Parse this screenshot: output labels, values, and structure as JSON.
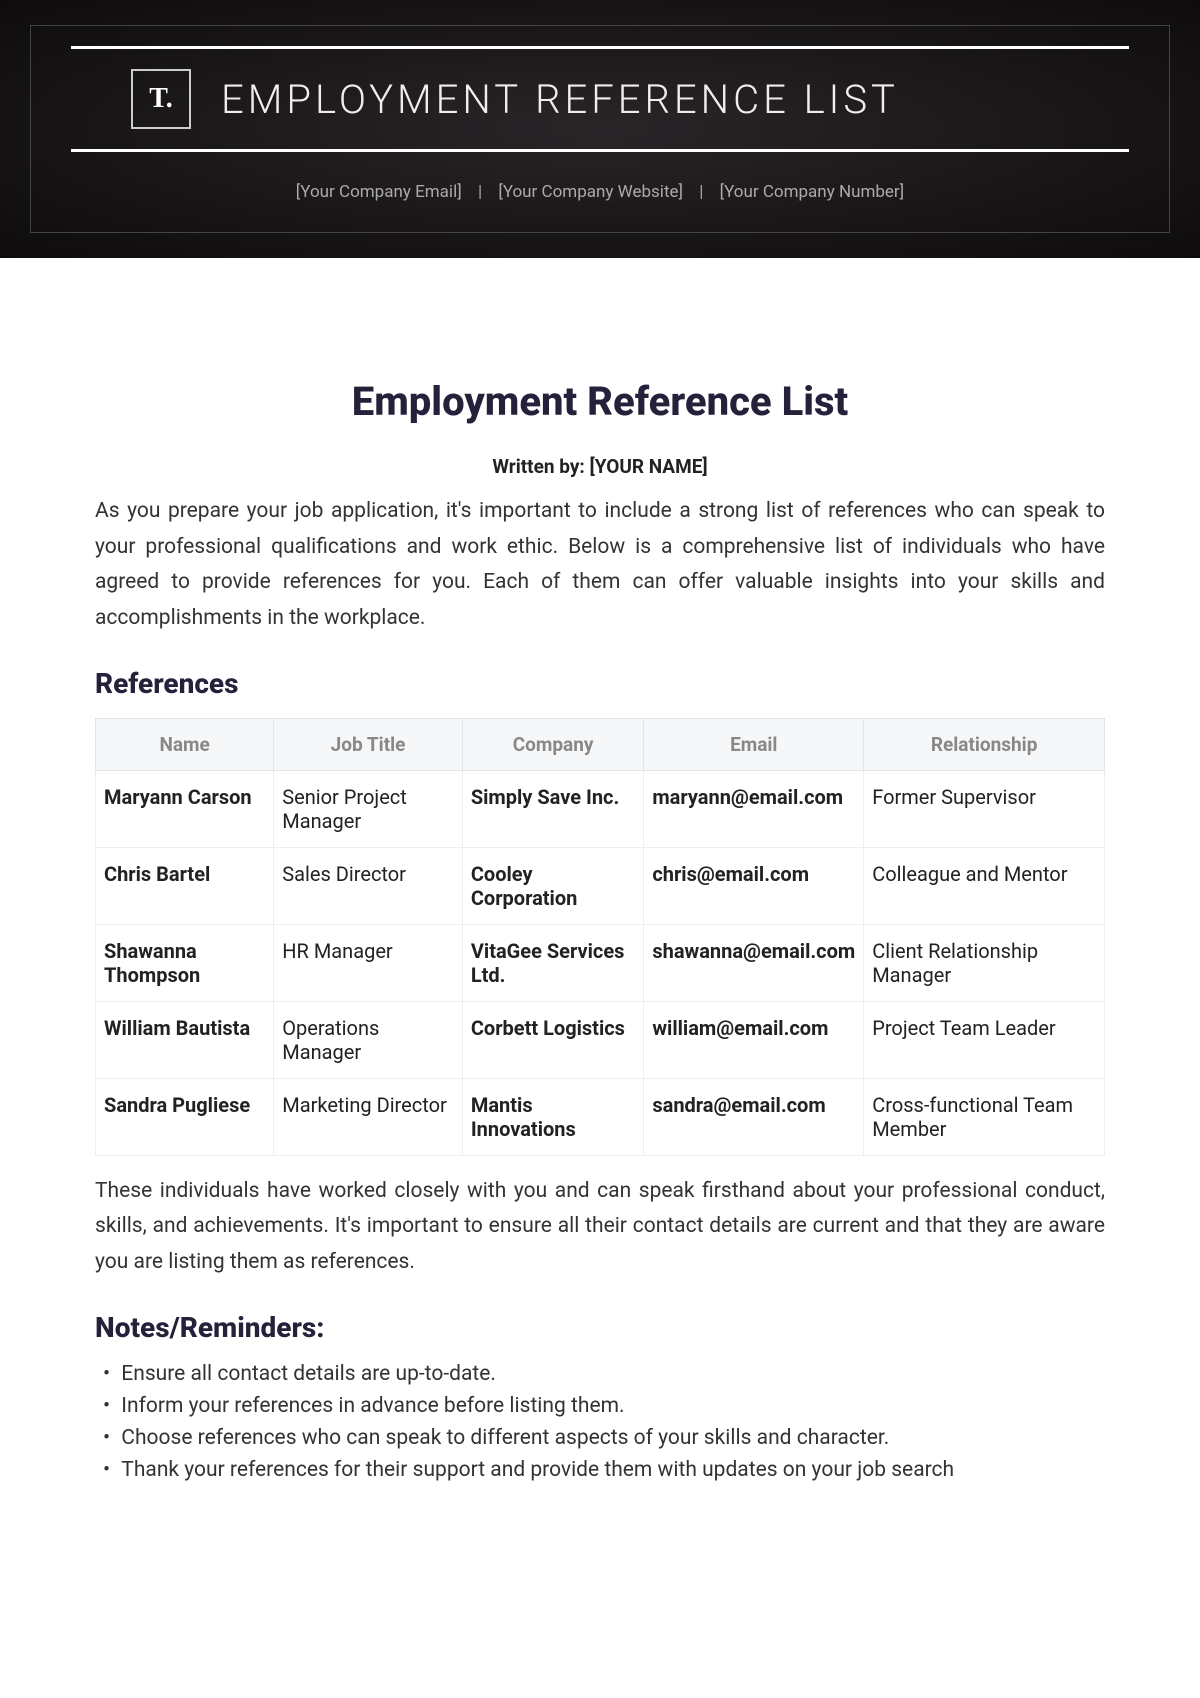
{
  "banner": {
    "logo_text": "T.",
    "title": "EMPLOYMENT REFERENCE LIST",
    "email": "[Your Company Email]",
    "website": "[Your Company Website]",
    "number": "[Your Company Number]",
    "sep": "|"
  },
  "doc": {
    "title": "Employment Reference List",
    "byline": "Written by: [YOUR NAME]",
    "intro": "As you prepare your job application, it's important to include a strong list of references who can speak to your professional qualifications and work ethic. Below is a comprehensive list of individuals who have agreed to provide references for you. Each of them can offer valuable insights into your skills and accomplishments in the workplace.",
    "references_heading": "References",
    "outro": "These individuals have worked closely with you and can speak firsthand about your professional conduct, skills, and achievements. It's important to ensure all their contact details are current and that they are aware you are listing them as references.",
    "notes_heading": "Notes/Reminders:"
  },
  "table": {
    "headers": {
      "name": "Name",
      "job_title": "Job Title",
      "company": "Company",
      "email": "Email",
      "relationship": "Relationship"
    },
    "rows": [
      {
        "name": "Maryann Carson",
        "job_title": "Senior Project Manager",
        "company": "Simply Save Inc.",
        "email": "maryann@email.com",
        "relationship": "Former Supervisor"
      },
      {
        "name": "Chris Bartel",
        "job_title": "Sales Director",
        "company": "Cooley Corporation",
        "email": "chris@email.com",
        "relationship": "Colleague and Mentor"
      },
      {
        "name": "Shawanna Thompson",
        "job_title": "HR Manager",
        "company": "VitaGee Services Ltd.",
        "email": "shawanna@email.com",
        "relationship": "Client Relationship Manager"
      },
      {
        "name": "William Bautista",
        "job_title": "Operations Manager",
        "company": "Corbett Logistics",
        "email": "william@email.com",
        "relationship": "Project Team Leader"
      },
      {
        "name": "Sandra Pugliese",
        "job_title": "Marketing Director",
        "company": "Mantis Innovations",
        "email": "sandra@email.com",
        "relationship": "Cross-functional Team Member"
      }
    ]
  },
  "notes": [
    "Ensure all contact details are up-to-date.",
    "Inform your references in advance before listing them.",
    "Choose references who can speak to different aspects of your skills and character.",
    "Thank your references for their support and provide them with updates on your job search"
  ]
}
